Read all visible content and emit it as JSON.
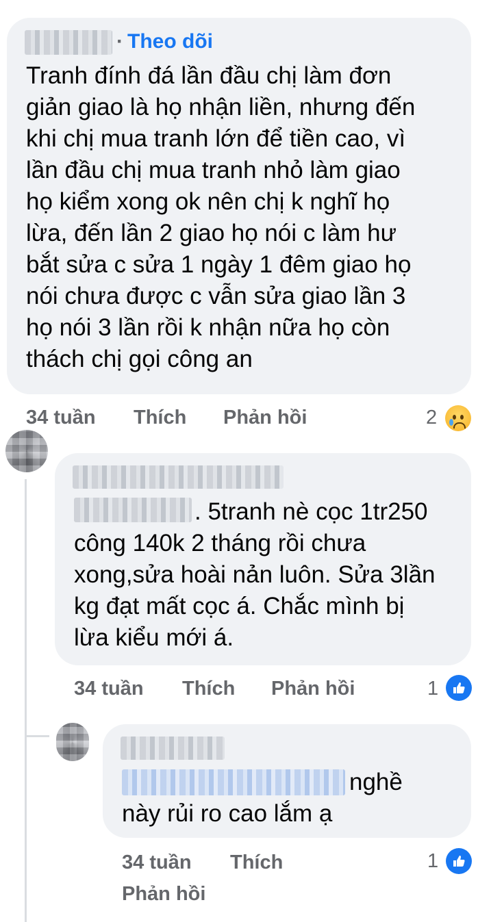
{
  "comment1": {
    "follow_label": "Theo dõi",
    "text": "Tranh đính đá lần đầu chị làm đơn\ngiản giao là họ nhận liền, nhưng đến\nkhi chị mua tranh lớn để tiền cao, vì\nlần đầu chị mua tranh nhỏ làm giao\nhọ kiểm xong ok nên chị k nghĩ họ\nlừa, đến lần 2 giao họ nói c làm hư\nbắt sửa c sửa 1 ngày 1 đêm giao họ\nnói chưa được c vẫn sửa giao lần 3\nhọ nói 3 lần rồi k nhận nữa họ còn\nthách chị gọi công an",
    "time": "34 tuần",
    "like_label": "Thích",
    "reply_label": "Phản hồi",
    "reaction_count": "2",
    "reaction_icon": "sad-emoji"
  },
  "comment2": {
    "text_first_line": ". 5tranh nè cọc 1tr250",
    "text_rest": "công 140k 2 tháng rồi chưa\nxong,sửa hoài nản luôn. Sửa 3lần\nkg đạt mất cọc á. Chắc mình bị\nlừa kiểu mới á.",
    "time": "34 tuần",
    "like_label": "Thích",
    "reply_label": "Phản hồi",
    "reaction_count": "1",
    "reaction_icon": "like-icon"
  },
  "comment3": {
    "text_first_line": "nghề",
    "text_rest": "này rủi ro cao lắm ạ",
    "time": "34 tuần",
    "like_label": "Thích",
    "reply_label": "Phản hồi",
    "reaction_count": "1",
    "reaction_icon": "like-icon"
  },
  "colors": {
    "bubble": "#f0f2f5",
    "link": "#1877f2",
    "meta": "#65676b",
    "text": "#050505"
  }
}
